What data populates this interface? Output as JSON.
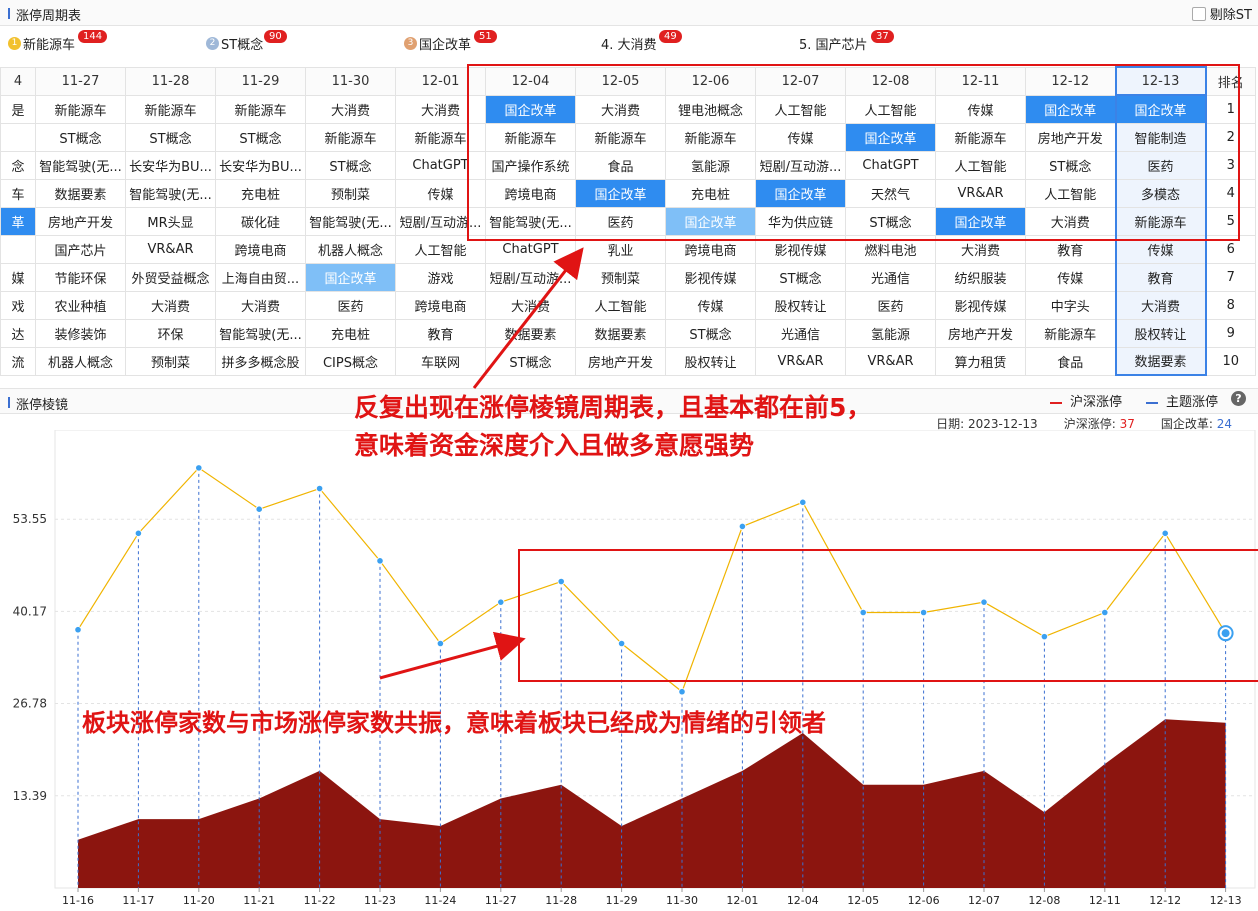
{
  "top_panel": {
    "title": "涨停周期表",
    "remove_st_label": "剔除ST"
  },
  "ranking": [
    {
      "rank": "1",
      "name": "新能源车",
      "count": "144",
      "medal_color": "#f2c12e"
    },
    {
      "rank": "2",
      "name": "ST概念",
      "count": "90",
      "medal_color": "#9fb8d8"
    },
    {
      "rank": "3",
      "name": "国企改革",
      "count": "51",
      "medal_color": "#e0a070"
    },
    {
      "rank": "4",
      "name": "4. 大消费",
      "count": "49"
    },
    {
      "rank": "5",
      "name": "5. 国产芯片",
      "count": "37"
    }
  ],
  "table": {
    "first_col_header": "4",
    "dates": [
      "11-27",
      "11-28",
      "11-29",
      "11-30",
      "12-01",
      "12-04",
      "12-05",
      "12-06",
      "12-07",
      "12-08",
      "12-11",
      "12-12",
      "12-13"
    ],
    "rank_header": "排名",
    "first_col": [
      "是",
      "",
      "念",
      "车",
      "革",
      "",
      "媒",
      "戏",
      "达",
      "流"
    ],
    "ranks": [
      "1",
      "2",
      "3",
      "4",
      "5",
      "6",
      "7",
      "8",
      "9",
      "10"
    ],
    "rows": [
      [
        "新能源车",
        "新能源车",
        "新能源车",
        "大消费",
        "大消费",
        "国企改革",
        "大消费",
        "锂电池概念",
        "人工智能",
        "人工智能",
        "传媒",
        "国企改革",
        "国企改革"
      ],
      [
        "ST概念",
        "ST概念",
        "ST概念",
        "新能源车",
        "新能源车",
        "新能源车",
        "新能源车",
        "新能源车",
        "传媒",
        "国企改革",
        "新能源车",
        "房地产开发",
        "智能制造"
      ],
      [
        "智能驾驶(无...",
        "长安华为BU...",
        "长安华为BU...",
        "ST概念",
        "ChatGPT",
        "国产操作系统",
        "食品",
        "氢能源",
        "短剧/互动游...",
        "ChatGPT",
        "人工智能",
        "ST概念",
        "医药"
      ],
      [
        "数据要素",
        "智能驾驶(无...",
        "充电桩",
        "预制菜",
        "传媒",
        "跨境电商",
        "国企改革",
        "充电桩",
        "国企改革",
        "天然气",
        "VR&AR",
        "人工智能",
        "多模态"
      ],
      [
        "房地产开发",
        "MR头显",
        "碳化硅",
        "智能驾驶(无...",
        "短剧/互动游...",
        "智能驾驶(无...",
        "医药",
        "国企改革",
        "华为供应链",
        "ST概念",
        "国企改革",
        "大消费",
        "新能源车"
      ],
      [
        "国产芯片",
        "VR&AR",
        "跨境电商",
        "机器人概念",
        "人工智能",
        "ChatGPT",
        "乳业",
        "跨境电商",
        "影视传媒",
        "燃料电池",
        "大消费",
        "教育",
        "传媒"
      ],
      [
        "节能环保",
        "外贸受益概念",
        "上海自由贸...",
        "国企改革",
        "游戏",
        "短剧/互动游...",
        "预制菜",
        "影视传媒",
        "ST概念",
        "光通信",
        "纺织服装",
        "传媒",
        "教育"
      ],
      [
        "农业种植",
        "大消费",
        "大消费",
        "医药",
        "跨境电商",
        "大消费",
        "人工智能",
        "传媒",
        "股权转让",
        "医药",
        "影视传媒",
        "中字头",
        "大消费"
      ],
      [
        "装修装饰",
        "环保",
        "智能驾驶(无...",
        "充电桩",
        "教育",
        "数据要素",
        "数据要素",
        "ST概念",
        "光通信",
        "氢能源",
        "房地产开发",
        "新能源车",
        "股权转让"
      ],
      [
        "机器人概念",
        "预制菜",
        "拼多多概念股",
        "CIPS概念",
        "车联网",
        "ST概念",
        "房地产开发",
        "股权转让",
        "VR&AR",
        "VR&AR",
        "算力租赁",
        "食品",
        "数据要素"
      ]
    ]
  },
  "bottom_panel": {
    "title": "涨停棱镜",
    "legend_market": "沪深涨停",
    "legend_theme": "主题涨停",
    "market_color": "#e02020",
    "theme_color": "#3b6fd1",
    "date_label": "日期:",
    "date_value": "2023-12-13",
    "market_label": "沪深涨停:",
    "market_value": "37",
    "theme_label": "国企改革:",
    "theme_value": "24"
  },
  "annotations": {
    "top_line1": "反复出现在涨停棱镜周期表，且基本都在前5，",
    "top_line2": "意味着资金深度介入且做多意愿强势",
    "bottom_line": "板块涨停家数与市场涨停家数共振，意味着板块已经成为情绪的引领者"
  },
  "chart_data": {
    "type": "line",
    "x": [
      "11-16",
      "11-17",
      "11-20",
      "11-21",
      "11-22",
      "11-23",
      "11-24",
      "11-27",
      "11-28",
      "11-29",
      "11-30",
      "12-01",
      "12-04",
      "12-05",
      "12-06",
      "12-07",
      "12-08",
      "12-11",
      "12-12",
      "12-13"
    ],
    "series": [
      {
        "name": "沪深涨停",
        "type": "line",
        "color": "#f0b400",
        "values": [
          37.5,
          51.5,
          61,
          55,
          58,
          47.5,
          35.5,
          41.5,
          44.5,
          35.5,
          28.5,
          52.5,
          56,
          40,
          40,
          41.5,
          36.5,
          40,
          51.5,
          37
        ]
      },
      {
        "name": "主题涨停",
        "type": "area",
        "color": "#8c150f",
        "values": [
          7,
          10,
          10,
          13,
          17,
          10,
          9,
          13,
          15,
          9,
          13,
          17,
          22.5,
          15,
          15,
          17,
          11,
          18,
          24.5,
          24
        ]
      }
    ],
    "yticks": [
      13.39,
      26.78,
      40.17,
      53.55
    ],
    "ylim": [
      0,
      66.5
    ]
  }
}
